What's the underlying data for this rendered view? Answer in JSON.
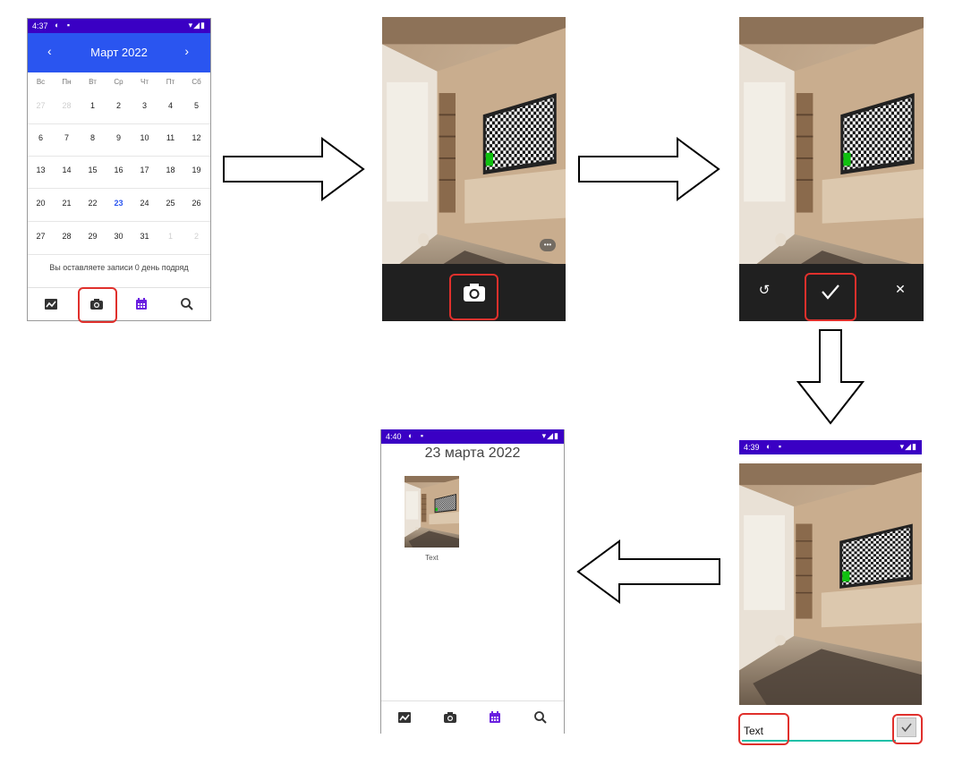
{
  "screen1": {
    "status_time": "4:37",
    "month_title": "Март  2022",
    "prev_label": "‹",
    "next_label": "›",
    "weekdays": [
      "Вс",
      "Пн",
      "Вт",
      "Ср",
      "Чт",
      "Пт",
      "Сб"
    ],
    "weeks": [
      [
        "27",
        "28",
        "1",
        "2",
        "3",
        "4",
        "5"
      ],
      [
        "6",
        "7",
        "8",
        "9",
        "10",
        "11",
        "12"
      ],
      [
        "13",
        "14",
        "15",
        "16",
        "17",
        "18",
        "19"
      ],
      [
        "20",
        "21",
        "22",
        "23",
        "24",
        "25",
        "26"
      ],
      [
        "27",
        "28",
        "29",
        "30",
        "31",
        "1",
        "2"
      ]
    ],
    "today": "23",
    "streak_text": "Вы оставляете записи 0 день подряд",
    "nav_icons": [
      "chart-icon",
      "camera-icon",
      "calendar-icon",
      "search-icon"
    ]
  },
  "screen2": {
    "more_label": "•••",
    "shutter_icon": "camera-icon"
  },
  "screen3": {
    "controls": [
      "undo-icon",
      "check-icon",
      "close-icon"
    ],
    "undo_label": "↺",
    "close_label": "✕"
  },
  "screen4": {
    "status_time": "4:39",
    "caption_value": "Text",
    "confirm_icon": "check-icon"
  },
  "screen5": {
    "status_time": "4:40",
    "date_title": "23 марта 2022",
    "entry_caption": "Text",
    "nav_icons": [
      "chart-icon",
      "camera-icon",
      "calendar-icon",
      "search-icon"
    ]
  },
  "colors": {
    "status_bar": "#3a00c4",
    "calendar_header": "#2a55f0",
    "highlight": "#e0302c",
    "camera_controls": "#202020",
    "accent_purple": "#6a1fe0"
  }
}
